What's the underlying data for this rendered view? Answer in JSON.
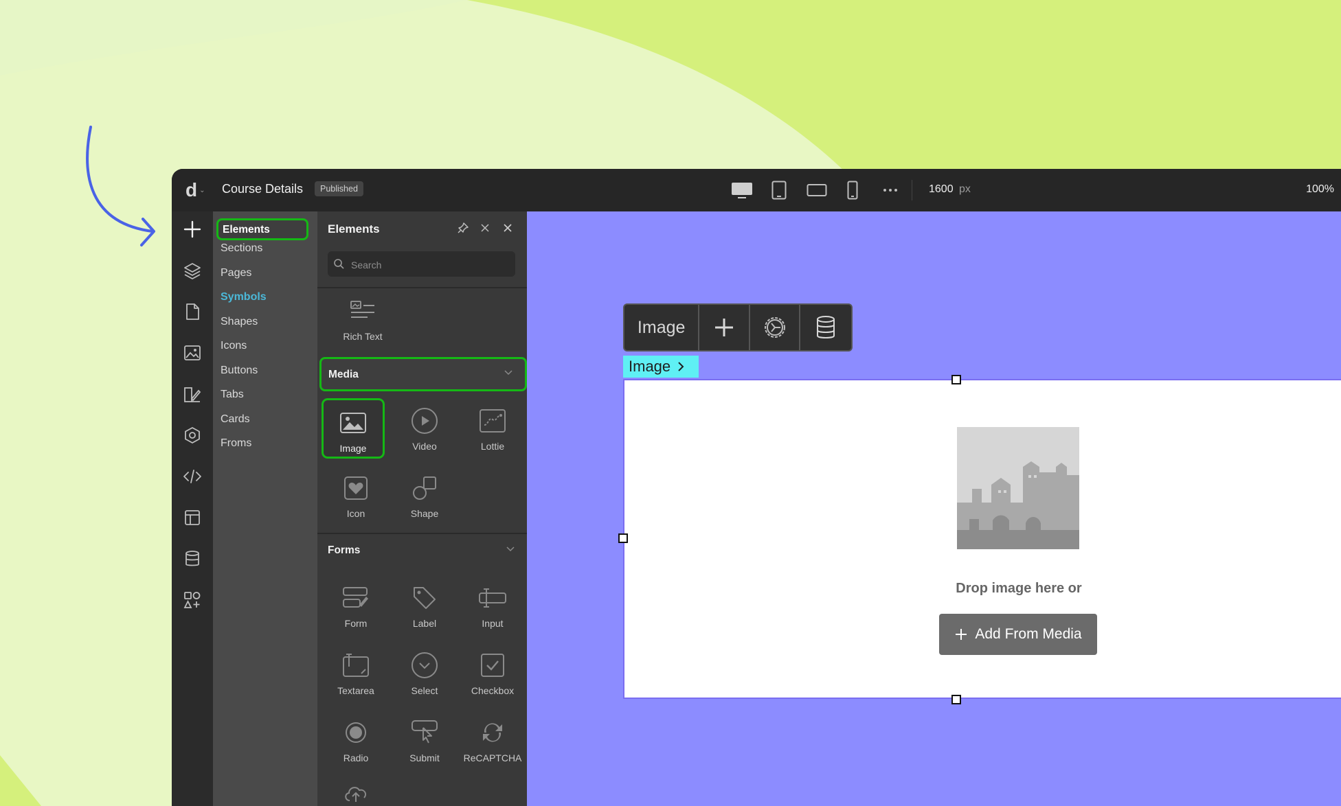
{
  "topbar": {
    "logo_letter": "d",
    "page_title": "Course Details",
    "status_badge": "Published",
    "canvas_width": "1600",
    "canvas_unit": "px",
    "zoom": "100%"
  },
  "categories": {
    "items": [
      "Elements",
      "Sections",
      "Pages",
      "Symbols",
      "Shapes",
      "Icons",
      "Buttons",
      "Tabs",
      "Cards",
      "Froms"
    ]
  },
  "panel": {
    "title": "Elements",
    "search_placeholder": "Search",
    "rich_text_label": "Rich Text",
    "media_section": "Media",
    "media_items": [
      "Image",
      "Video",
      "Lottie",
      "Icon",
      "Shape"
    ],
    "forms_section": "Forms",
    "form_items": [
      "Form",
      "Label",
      "Input",
      "Textarea",
      "Select",
      "Checkbox",
      "Radio",
      "Submit",
      "ReCAPTCHA"
    ]
  },
  "canvas": {
    "toolbar_label": "Image",
    "breadcrumb": "Image",
    "drop_text": "Drop image here or",
    "add_button": "Add From Media"
  },
  "colors": {
    "highlight": "#15b815",
    "canvas_bg": "#8c8cff",
    "breadcrumb_bg": "#5ff0f4",
    "arrow": "#4a63e6",
    "symbols_link": "#4bb8d8"
  }
}
